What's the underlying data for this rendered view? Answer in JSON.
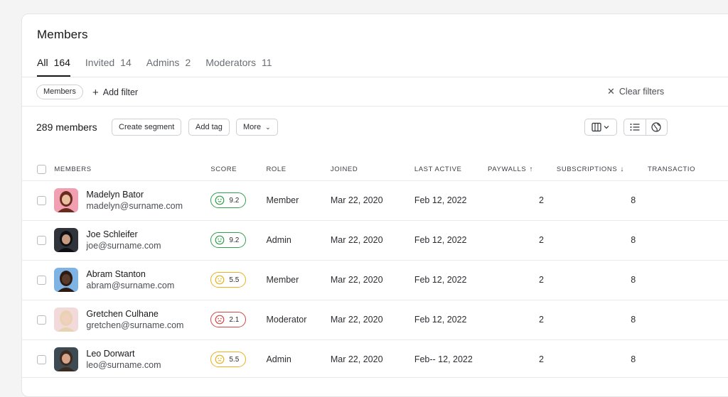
{
  "page": {
    "title": "Members"
  },
  "tabs": [
    {
      "label": "All",
      "count": "164"
    },
    {
      "label": "Invited",
      "count": "14"
    },
    {
      "label": "Admins",
      "count": "2"
    },
    {
      "label": "Moderators",
      "count": "11"
    }
  ],
  "filters": {
    "chip_label": "Members",
    "add_filter_label": "Add filter",
    "clear_filters_label": "Clear filters"
  },
  "toolbar": {
    "count_label": "289 members",
    "create_segment_label": "Create segment",
    "add_tag_label": "Add tag",
    "more_label": "More"
  },
  "table": {
    "headers": {
      "members": "MEMBERS",
      "score": "SCORE",
      "role": "ROLE",
      "joined": "JOINED",
      "last_active": "LAST ACTIVE",
      "paywalls": "PAYWALLS",
      "subscriptions": "SUBSCRIPTIONS",
      "transactions": "TRANSACTIO"
    },
    "rows": [
      {
        "name": "Madelyn Bator",
        "email": "madelyn@surname.com",
        "score": "9.2",
        "mood": "happy",
        "role": "Member",
        "joined": "Mar 22, 2020",
        "last_active": "Feb 12, 2022",
        "paywalls": "2",
        "subscriptions": "8"
      },
      {
        "name": "Joe Schleifer",
        "email": "joe@surname.com",
        "score": "9.2",
        "mood": "happy",
        "role": "Admin",
        "joined": "Mar 22, 2020",
        "last_active": "Feb 12, 2022",
        "paywalls": "2",
        "subscriptions": "8"
      },
      {
        "name": "Abram Stanton",
        "email": "abram@surname.com",
        "score": "5.5",
        "mood": "neutral",
        "role": "Member",
        "joined": "Mar 22, 2020",
        "last_active": "Feb 12, 2022",
        "paywalls": "2",
        "subscriptions": "8"
      },
      {
        "name": "Gretchen Culhane",
        "email": "gretchen@surname.com",
        "score": "2.1",
        "mood": "sad",
        "role": "Moderator",
        "joined": "Mar 22, 2020",
        "last_active": "Feb 12, 2022",
        "paywalls": "2",
        "subscriptions": "8"
      },
      {
        "name": "Leo Dorwart",
        "email": "leo@surname.com",
        "score": "5.5",
        "mood": "neutral",
        "role": "Admin",
        "joined": "Mar 22, 2020",
        "last_active": "Feb-- 12, 2022",
        "paywalls": "2",
        "subscriptions": "8"
      }
    ]
  },
  "colors": {
    "happy": "#2fa14a",
    "neutral": "#e9b21a",
    "sad": "#d64545"
  },
  "icons": {
    "column-view": "columns-icon",
    "list-view": "list-icon",
    "globe": "globe-icon"
  }
}
